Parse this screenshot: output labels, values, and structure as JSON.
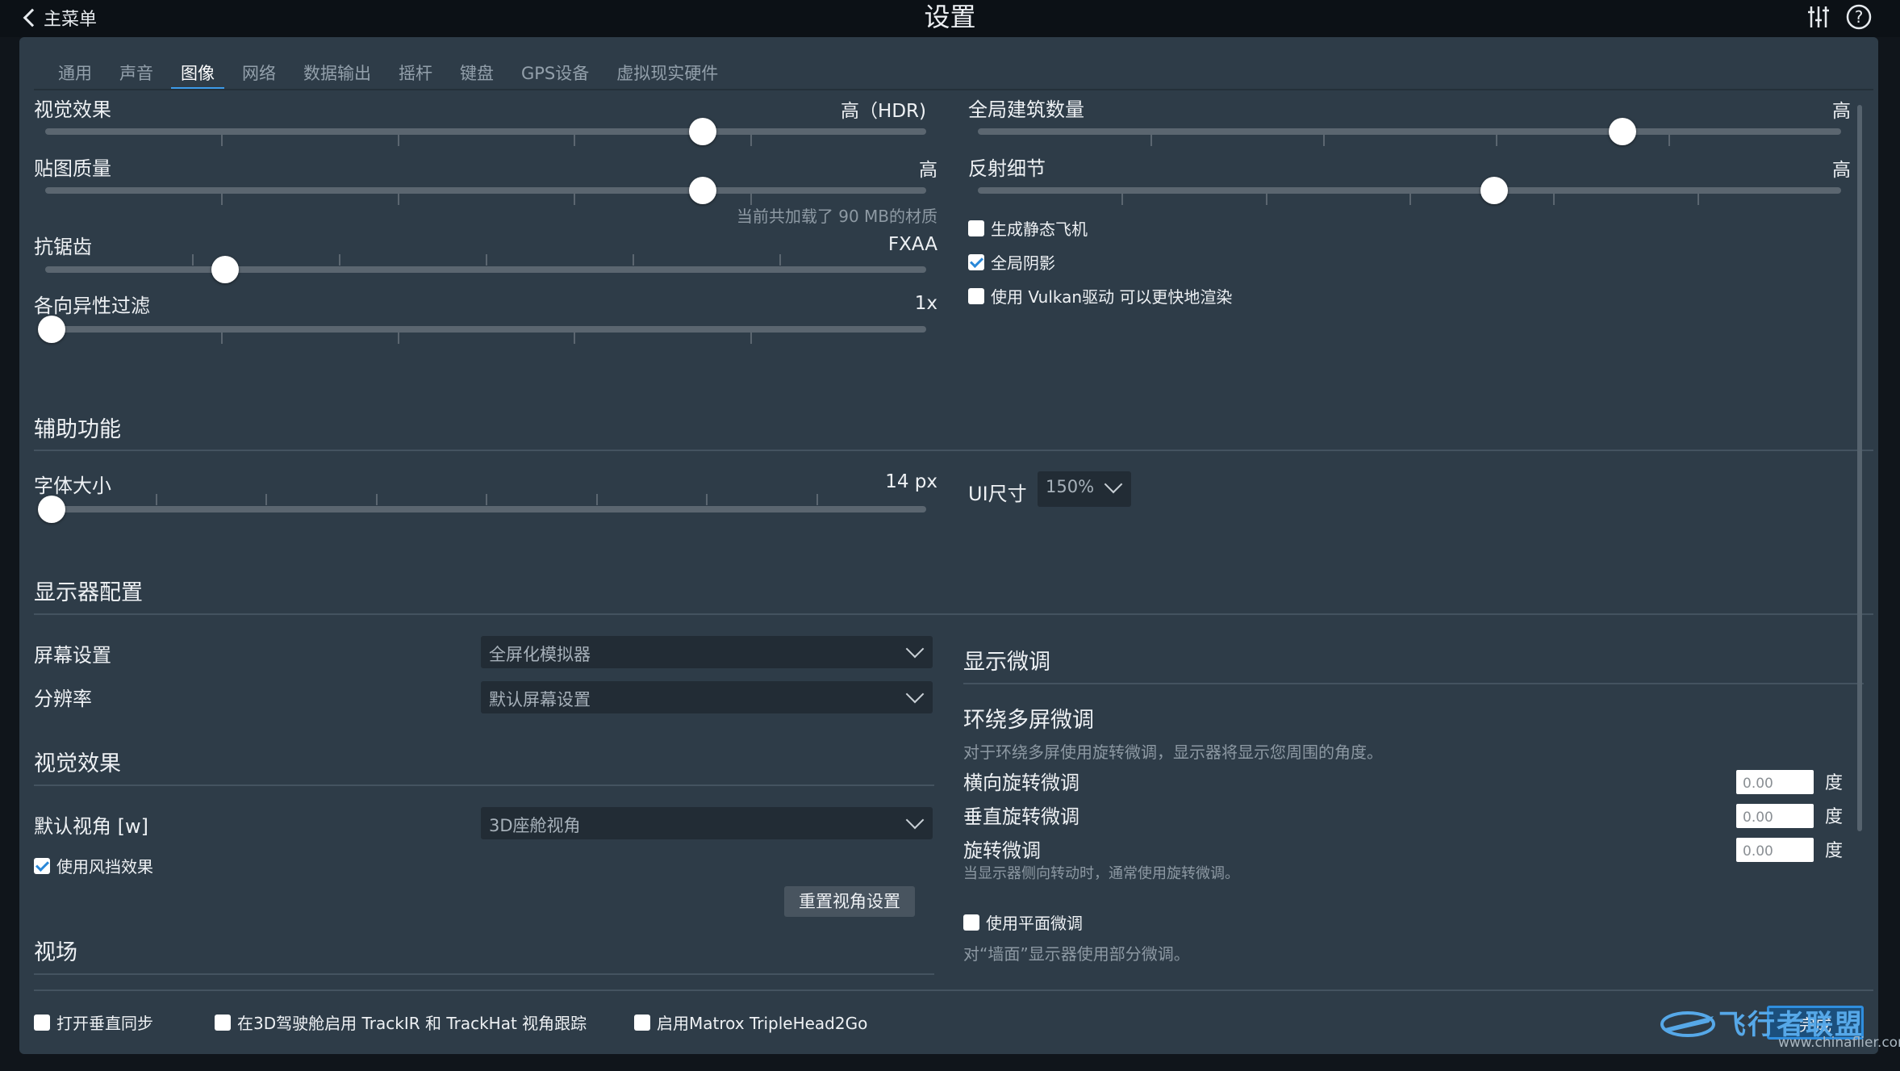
{
  "header": {
    "back_label": "主菜单",
    "title": "设置"
  },
  "tabs": [
    "通用",
    "声音",
    "图像",
    "网络",
    "数据输出",
    "摇杆",
    "键盘",
    "GPS设备",
    "虚拟现实硬件"
  ],
  "graphics": {
    "visual_effects": {
      "label": "视觉效果",
      "value": "高（HDR)",
      "level": 0.75
    },
    "texture_quality": {
      "label": "贴图质量",
      "value": "高",
      "level": 0.75,
      "note": "当前共加载了 90 MB的材质"
    },
    "antialiasing": {
      "label": "抗锯齿",
      "value": "FXAA",
      "level": 0.2
    },
    "anisotropic": {
      "label": "各向异性过滤",
      "value": "1x",
      "level": 0.0
    },
    "buildings": {
      "label": "全局建筑数量",
      "value": "高",
      "level": 0.75
    },
    "reflection": {
      "label": "反射细节",
      "value": "高",
      "level": 0.6
    },
    "checkboxes": [
      {
        "label": "生成静态飞机",
        "checked": false
      },
      {
        "label": "全局阴影",
        "checked": true
      },
      {
        "label": "使用 Vulkan驱动 可以更快地渲染",
        "checked": false
      }
    ]
  },
  "accessibility": {
    "title": "辅助功能",
    "font_size": {
      "label": "字体大小",
      "value": "14 px",
      "level": 0.0
    },
    "ui_size": {
      "label": "UI尺寸",
      "value": "150%"
    }
  },
  "monitor": {
    "title": "显示器配置",
    "screen": {
      "label": "屏幕设置",
      "value": "全屏化模拟器"
    },
    "resolution": {
      "label": "分辨率",
      "value": "默认屏幕设置"
    }
  },
  "view": {
    "title": "视觉效果",
    "default_view": {
      "label": "默认视角 [w]",
      "value": "3D座舱视角"
    },
    "windshield": {
      "label": "使用风挡效果",
      "checked": true
    },
    "reset_button": "重置视角设置"
  },
  "fov_title": "视场",
  "fine_tune": {
    "title": "显示微调",
    "surround_title": "环绕多屏微调",
    "surround_desc": "对于环绕多屏使用旋转微调，显示器将显示您周围的角度。",
    "rows": [
      {
        "label": "横向旋转微调",
        "value": "0.00",
        "unit": "度"
      },
      {
        "label": "垂直旋转微调",
        "value": "0.00",
        "unit": "度"
      },
      {
        "label": "旋转微调",
        "value": "0.00",
        "unit": "度"
      }
    ],
    "rotate_note": "当显示器侧向转动时，通常使用旋转微调。",
    "flat": {
      "label": "使用平面微调",
      "checked": false
    },
    "flat_desc": "对“墙面”显示器使用部分微调。"
  },
  "bottom_checkboxes": [
    {
      "label": "打开垂直同步",
      "checked": false
    },
    {
      "label": "在3D驾驶舱启用 TrackIR 和 TrackHat 视角跟踪",
      "checked": false
    },
    {
      "label": "启用Matrox TripleHead2Go",
      "checked": false
    }
  ],
  "done_label": "完成",
  "watermark": {
    "name": "飞行者联盟",
    "url": "www.chinaflier.com"
  },
  "colors": {
    "panel": "#2e3c48",
    "accent": "#3d9be9",
    "thumb": "#ffffff",
    "track": "#5b6670"
  }
}
